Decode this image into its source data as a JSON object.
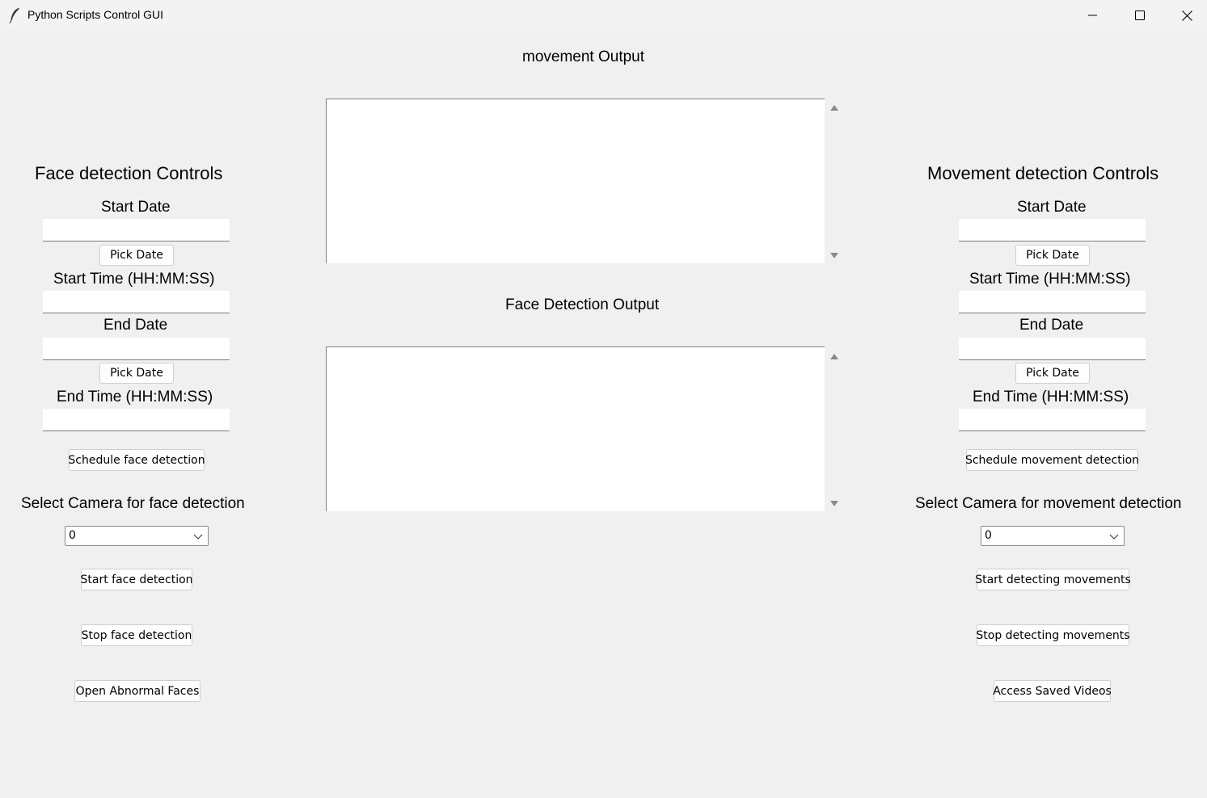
{
  "window": {
    "title": "Python Scripts Control GUI",
    "controls": [
      "minimize",
      "maximize",
      "close"
    ]
  },
  "face_panel": {
    "heading": "Face detection Controls",
    "start_date_label": "Start Date",
    "start_date_value": "",
    "pick_date_1": "Pick Date",
    "start_time_label": "Start Time (HH:MM:SS)",
    "start_time_value": "",
    "end_date_label": "End Date",
    "end_date_value": "",
    "pick_date_2": "Pick Date",
    "end_time_label": "End Time (HH:MM:SS)",
    "end_time_value": "",
    "schedule_button": "Schedule face detection",
    "camera_label": "Select Camera for face detection",
    "camera_value": "0",
    "start_button": "Start face detection",
    "stop_button": "Stop face detection",
    "open_button": "Open Abnormal Faces"
  },
  "movement_panel": {
    "heading": "Movement detection Controls",
    "start_date_label": "Start Date",
    "start_date_value": "",
    "pick_date_1": "Pick Date",
    "start_time_label": "Start Time (HH:MM:SS)",
    "start_time_value": "",
    "end_date_label": "End Date",
    "end_date_value": "",
    "pick_date_2": "Pick Date",
    "end_time_label": "End Time (HH:MM:SS)",
    "end_time_value": "",
    "schedule_button": "Schedule movement detection",
    "camera_label": "Select Camera for movement detection",
    "camera_value": "0",
    "start_button": "Start detecting movements",
    "stop_button": "Stop detecting movements",
    "access_button": "Access Saved Videos"
  },
  "outputs": {
    "movement_label": "movement Output",
    "movement_text": "",
    "face_label": "Face Detection Output",
    "face_text": ""
  },
  "icons": {
    "app": "feather-icon",
    "minimize": "minimize-icon",
    "maximize": "maximize-icon",
    "close": "close-icon",
    "dropdown": "chevron-down-icon",
    "scroll_up": "scroll-up-arrow-icon",
    "scroll_down": "scroll-down-arrow-icon"
  }
}
